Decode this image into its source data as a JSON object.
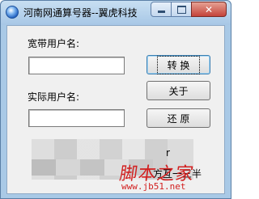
{
  "window": {
    "title": "河南网通算号器--翼虎科技",
    "controls": {
      "minimize_icon": "minimize-icon",
      "maximize_icon": "maximize-icon",
      "close_label": "✕"
    }
  },
  "form": {
    "broadband_label": "宽带用户名:",
    "broadband_value": "",
    "actual_label": "实际用户名:",
    "actual_value": ""
  },
  "buttons": {
    "convert": "转  换",
    "about": "关于",
    "restore": "还  原"
  },
  "obscured_area": {
    "partial_text_1": "r",
    "partial_text_2": "方互一三半"
  },
  "watermark": {
    "logo_text": "脚本之家",
    "url": "www.jb51.net"
  }
}
